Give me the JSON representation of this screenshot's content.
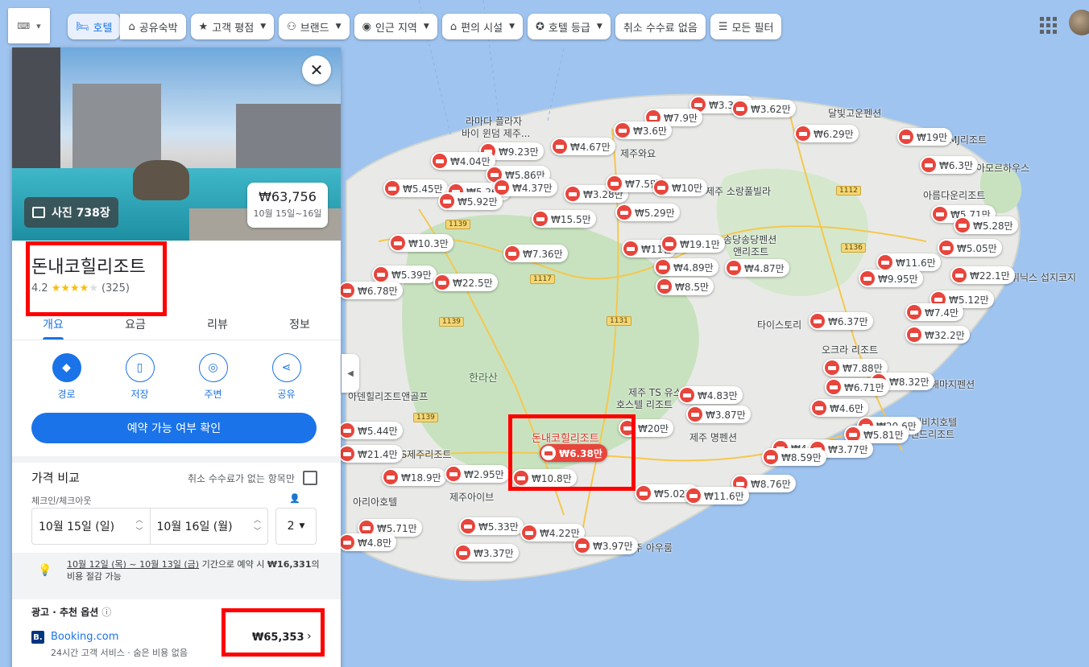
{
  "filters": {
    "keyboard": "⌨",
    "hotels": "호텔",
    "vacation_rentals": "공유숙박",
    "guest_rating": "고객 평점",
    "brand": "브랜드",
    "nearby": "인근 지역",
    "amenities": "편의 시설",
    "hotel_class": "호텔 등급",
    "free_cancel": "취소 수수료 없음",
    "all_filters": "모든 필터"
  },
  "hotel": {
    "name": "돈내코힐리조트",
    "rating": "4.2",
    "reviews": "(325)",
    "photos": "사진 738장",
    "price": "₩63,756",
    "dates": "10월 15일~16일"
  },
  "tabs": [
    "개요",
    "요금",
    "리뷰",
    "정보"
  ],
  "actions": [
    "경로",
    "저장",
    "주변",
    "공유"
  ],
  "reserve": "예약 가능 여부 확인",
  "compare": {
    "title": "가격 비교",
    "free_only": "취소 수수료가 없는 항목만",
    "dates_label": "체크인/체크아웃",
    "checkin": "10월 15일 (일)",
    "checkout": "10월 16일 (월)",
    "guests": "2"
  },
  "tip": {
    "dates": "10월 12일 (목) ~ 10월 13일 (금)",
    "text1": " 기간으로 예약 시 ",
    "amount": "₩16,331",
    "text2": "의",
    "line2": "비용 절감 가능"
  },
  "ads": {
    "label": "광고 · 추천 옵션",
    "info": "ⓘ",
    "site": "Booking.com",
    "logo": "B.",
    "sub": "24시간 고객 서비스 · 숨은 비용 없음",
    "price": "₩65,353"
  },
  "map": {
    "labels": [
      {
        "t": "라마다 플라자"
      },
      {
        "t": "바이 윈덤 제주..."
      },
      {
        "t": "달빛고운펜션"
      },
      {
        "t": "제주와요"
      },
      {
        "t": "MJ리조트"
      },
      {
        "t": "아모르하우스"
      },
      {
        "t": "제주 소랑풀빌라"
      },
      {
        "t": "아름다운리조트"
      },
      {
        "t": "송당송당펜션"
      },
      {
        "t": "앤리조트"
      },
      {
        "t": "휘닉스 섭지코지"
      },
      {
        "t": "타이스토리"
      },
      {
        "t": "오크라 리조트"
      },
      {
        "t": "해마지펜션"
      },
      {
        "t": "한라산"
      },
      {
        "t": "제주 TS 유스"
      },
      {
        "t": "호스텔 리조트"
      },
      {
        "t": "아덴힐리조트앤골프"
      },
      {
        "t": "해비치호텔"
      },
      {
        "t": "앤드리조트"
      },
      {
        "t": "돈내코힐리조트"
      },
      {
        "t": "제주 명펜션"
      },
      {
        "t": "ES제주리조트"
      },
      {
        "t": "제주아이브"
      },
      {
        "t": "아리아호텔"
      },
      {
        "t": "제주 아우룸"
      }
    ],
    "roads": [
      "1139",
      "1117",
      "1139",
      "1131",
      "1139",
      "1112",
      "1136"
    ],
    "pins": [
      "₩3.36만",
      "₩3.62만",
      "₩7.9만",
      "₩3.6만",
      "₩6.29만",
      "₩19만",
      "₩4.67만",
      "₩9.23만",
      "₩4.04만",
      "₩5.86만",
      "₩6.3만",
      "₩5.45만",
      "₩5.26만",
      "₩4.37만",
      "₩3.28만",
      "₩7.5만",
      "₩10만",
      "₩5.92만",
      "₩15.5만",
      "₩5.29만",
      "₩5.71만",
      "₩5.28만",
      "₩10.3만",
      "₩7.36만",
      "₩11만",
      "₩19.1만",
      "₩5.05만",
      "₩4.89만",
      "₩4.87만",
      "₩11.6만",
      "₩5.39만",
      "₩6.78만",
      "₩22.5만",
      "₩8.5만",
      "₩9.95만",
      "₩22.1만",
      "₩5.12만",
      "₩7.4만",
      "₩6.37만",
      "₩32.2만",
      "₩7.88만",
      "₩8.32만",
      "₩6.71만",
      "₩4.83만",
      "₩4.6만",
      "₩3.87만",
      "₩20.6만",
      "₩5.81만",
      "₩20만",
      "₩4.74만",
      "₩3.77만",
      "₩21.4만",
      "₩8.59만",
      "₩6.38만",
      "₩18.9만",
      "₩2.95만",
      "₩10.8만",
      "₩8.76만",
      "₩5.02만",
      "₩11.6만",
      "₩5.33만",
      "₩4.22만",
      "₩5.71만",
      "₩3.37만",
      "₩3.97만",
      "₩5.44만",
      "₩4.8만"
    ]
  }
}
